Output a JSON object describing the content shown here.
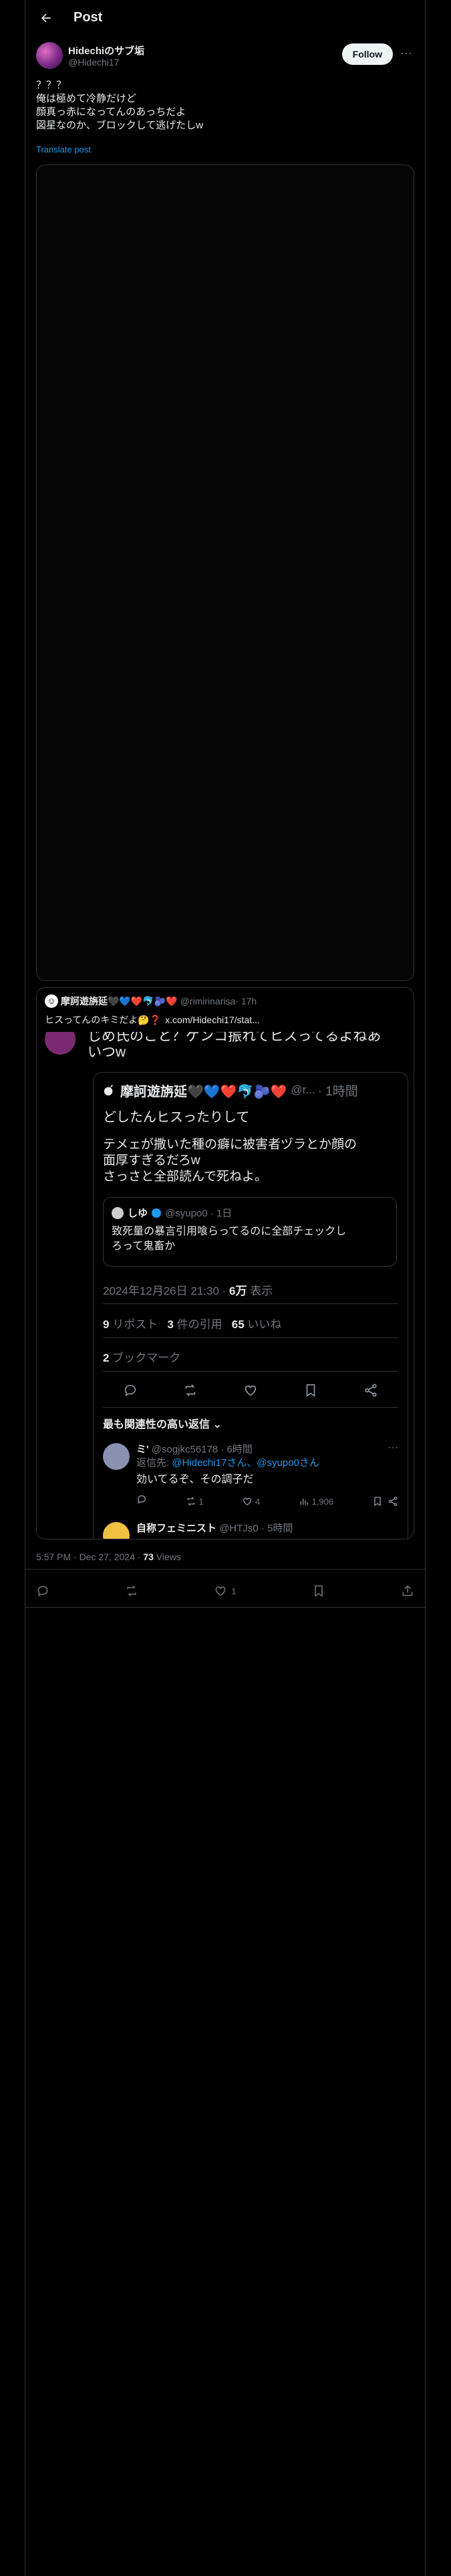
{
  "header": {
    "title": "Post"
  },
  "author": {
    "name": "Hidechiのサブ垢",
    "handle": "@Hidechi17"
  },
  "follow_label": "Follow",
  "more_symbol": "···",
  "post_lines": [
    "？？？",
    "俺は極めて冷静だけど",
    "顔真っ赤になってんのあっちだよ",
    "図星なのか、ブロックして逃げたしw"
  ],
  "translate_label": "Translate post",
  "quote": {
    "avatar_glyph": "☺",
    "name": "摩訶遊旃延🖤💙❤️🐬🫐❤️",
    "handle": "@rimirinarisa",
    "time": "· 17h",
    "text": "ヒスってんのキミだよ🤔❓",
    "link": "x.com/Hidechi17/stat..."
  },
  "screenshot": {
    "top_line": "じめ氏のこと？ゲンコ振れてヒスってるよねあ",
    "line2": "いつw",
    "inner": {
      "name": "摩訶遊旃延🖤💙❤️🐬🫐❤️",
      "handle": "@r...",
      "time": "· 1時間",
      "line1": "どしたんヒスったりして",
      "line2a": "テメェが撒いた種の癖に被害者ヅラとか顔の",
      "line2b": "面厚すぎるだろw",
      "line2c": "さっさと全部読んで死ねよ。",
      "quoted": {
        "name": "しゆ",
        "meta": "@syupo0 · 1日",
        "text_a": "致死量の暴言引用喰らってるのに全部チェックし",
        "text_b": "ろって鬼畜か"
      },
      "date": "2024年12月26日 21:30 · ",
      "views_count": "6万",
      "views_label": "表示",
      "reposts_count": "9",
      "reposts_label": "リポスト",
      "quotes_count": "3",
      "quotes_label": "件の引用",
      "likes_count": "65",
      "likes_label": "いいね",
      "bookmarks_count": "2",
      "bookmarks_label": "ブックマーク",
      "sort_label": "最も関連性の高い返信 ⌄",
      "reply": {
        "name": "ミ'",
        "meta": "@sogjkc56178 · 6時間",
        "to_prefix": "返信先: ",
        "to_users": "@Hidechi17さん、@syupo0さん",
        "text": "効いてるぞ、その調子だ",
        "reposts": "1",
        "likes": "4",
        "views": "1,906"
      },
      "reply2": {
        "name": "自称フェミニスト",
        "meta": "@HTJs0 · 5時間"
      }
    }
  },
  "meta": {
    "time": "5:57 PM · Dec 27, 2024 · ",
    "views_count": "73",
    "views_label": "Views"
  },
  "actions": {
    "likes": "1"
  }
}
